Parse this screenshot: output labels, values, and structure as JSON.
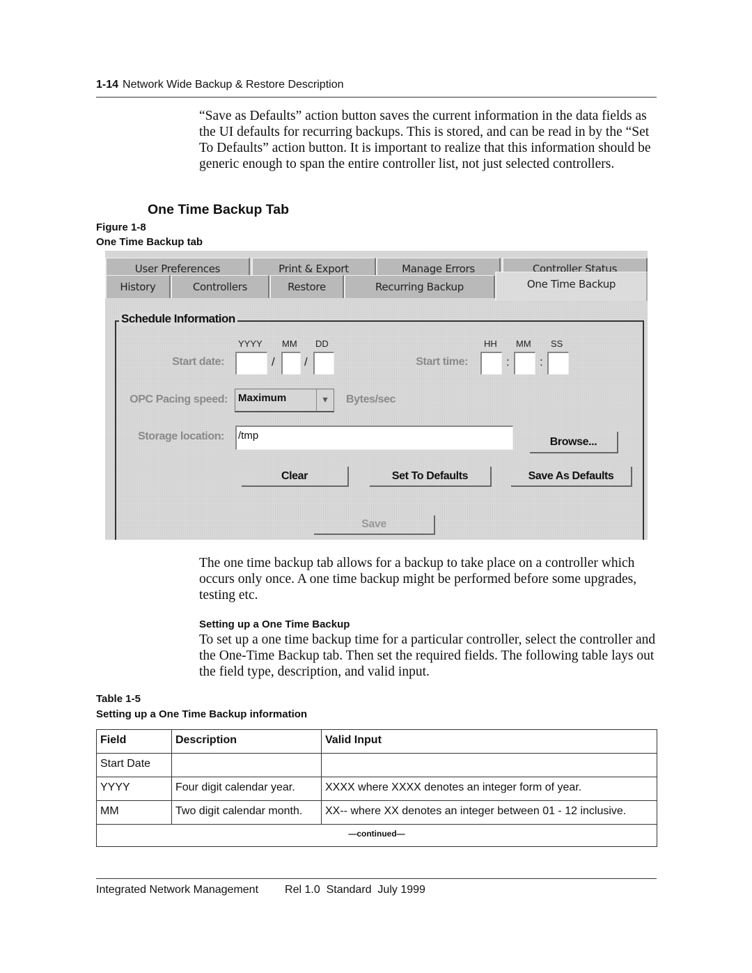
{
  "header": {
    "page_number": "1-14",
    "title": "Network Wide Backup & Restore Description"
  },
  "intro_paragraph": "“Save as Defaults” action button saves the current information in the data fields as the UI defaults for recurring backups. This is stored, and can be read in by the “Set To Defaults” action button. It is important to realize that this information should be generic enough to span the entire controller list, not just selected controllers.",
  "section_title": "One Time Backup Tab",
  "figure": {
    "number": "Figure 1-8",
    "caption": "One Time Backup tab"
  },
  "screenshot": {
    "tabs_row1": [
      "User Preferences",
      "Print & Export",
      "Manage Errors",
      "Controller Status"
    ],
    "tabs_row2": [
      "History",
      "Controllers",
      "Restore",
      "Recurring Backup"
    ],
    "active_tab": "One Time Backup",
    "group_title": "Schedule Information",
    "start_date_label": "Start date:",
    "date_headers": [
      "YYYY",
      "MM",
      "DD"
    ],
    "date_separator": "/",
    "start_time_label": "Start time:",
    "time_headers": [
      "HH",
      "MM",
      "SS"
    ],
    "time_separator": ":",
    "pacing_label": "OPC Pacing speed:",
    "pacing_value": "Maximum",
    "pacing_unit": "Bytes/sec",
    "storage_label": "Storage location:",
    "storage_value": "/tmp",
    "browse_button": "Browse...",
    "clear_button": "Clear",
    "set_defaults_button": "Set To Defaults",
    "save_defaults_button": "Save As Defaults",
    "save_button": "Save"
  },
  "description_paragraph": "The one time backup tab allows for a backup to take place on a controller which occurs only once. A one time backup might be performed before some upgrades, testing etc.",
  "subsection_title": "Setting up a One Time Backup",
  "setup_paragraph": "To set up a one time backup time for a particular controller, select the controller and the One-Time Backup tab. Then set the required fields.  The following table lays out the field type, description, and valid input.",
  "table": {
    "number": "Table 1-5",
    "caption": "Setting up a One Time Backup information",
    "headers": [
      "Field",
      "Description",
      "Valid Input"
    ],
    "rows": [
      [
        "Start Date",
        "",
        ""
      ],
      [
        "YYYY",
        "Four digit calendar year.",
        "XXXX where XXXX denotes an integer form of year."
      ],
      [
        "MM",
        "Two digit calendar month.",
        "XX-- where XX denotes an integer between 01 - 12 inclusive."
      ]
    ],
    "continued": "—continued—"
  },
  "footer": {
    "product": "Integrated Network Management",
    "release": "Rel 1.0  Standard  July 1999"
  }
}
